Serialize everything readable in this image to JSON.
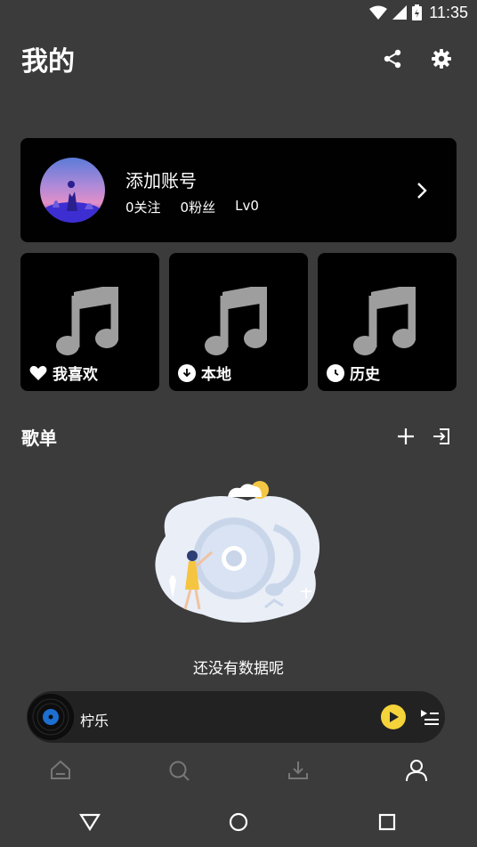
{
  "status_bar": {
    "time": "11:35",
    "icons": [
      "wifi-icon",
      "signal-icon",
      "battery-icon"
    ]
  },
  "header": {
    "title": "我的",
    "share_icon": "share-icon",
    "settings_icon": "gear-icon"
  },
  "account": {
    "name": "添加账号",
    "following": "0关注",
    "followers": "0粉丝",
    "level": "Lv0"
  },
  "tiles": [
    {
      "label": "我喜欢",
      "icon": "heart-icon"
    },
    {
      "label": "本地",
      "icon": "download-icon"
    },
    {
      "label": "历史",
      "icon": "clock-icon"
    }
  ],
  "playlists": {
    "title": "歌单",
    "empty_text": "还没有数据呢"
  },
  "player": {
    "track": "柠乐"
  },
  "bottom_nav": [
    "home-icon",
    "search-icon",
    "download-icon",
    "profile-icon"
  ],
  "colors": {
    "background": "#3b3b3b",
    "card": "#000000",
    "accent_yellow": "#f5d33a"
  }
}
